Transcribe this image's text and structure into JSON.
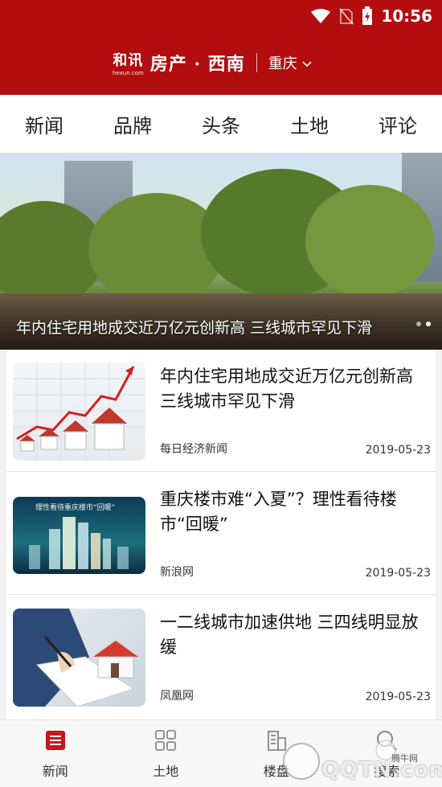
{
  "status_bar": {
    "time": "10:56"
  },
  "header": {
    "logo_text": "和讯",
    "logo_sub": "hexun.com",
    "brand": "房产 · 西南",
    "city": "重庆",
    "accent_color": "#b30d0f"
  },
  "tabs": [
    "新闻",
    "品牌",
    "头条",
    "土地",
    "评论"
  ],
  "banner": {
    "caption": "年内住宅用地成交近万亿元创新高 三线城市罕见下滑"
  },
  "news": [
    {
      "title": "年内住宅用地成交近万亿元创新高 三线城市罕见下滑",
      "source": "每日经济新闻",
      "date": "2019-05-23"
    },
    {
      "title": "重庆楼市难“入夏”？理性看待楼市“回暖”",
      "source": "新浪网",
      "date": "2019-05-23",
      "thumb_text": "理性看待重庆楼市“回暖”"
    },
    {
      "title": "一二线城市加速供地 三四线明显放缓",
      "source": "凤凰网",
      "date": "2019-05-23"
    }
  ],
  "bottom_nav": [
    {
      "label": "新闻",
      "icon": "news-icon"
    },
    {
      "label": "土地",
      "icon": "grid-icon"
    },
    {
      "label": "楼盘",
      "icon": "building-icon"
    },
    {
      "label": "搜索",
      "icon": "search-icon"
    }
  ],
  "watermark": {
    "text": "QQTN.com",
    "sub": "腾牛网"
  }
}
